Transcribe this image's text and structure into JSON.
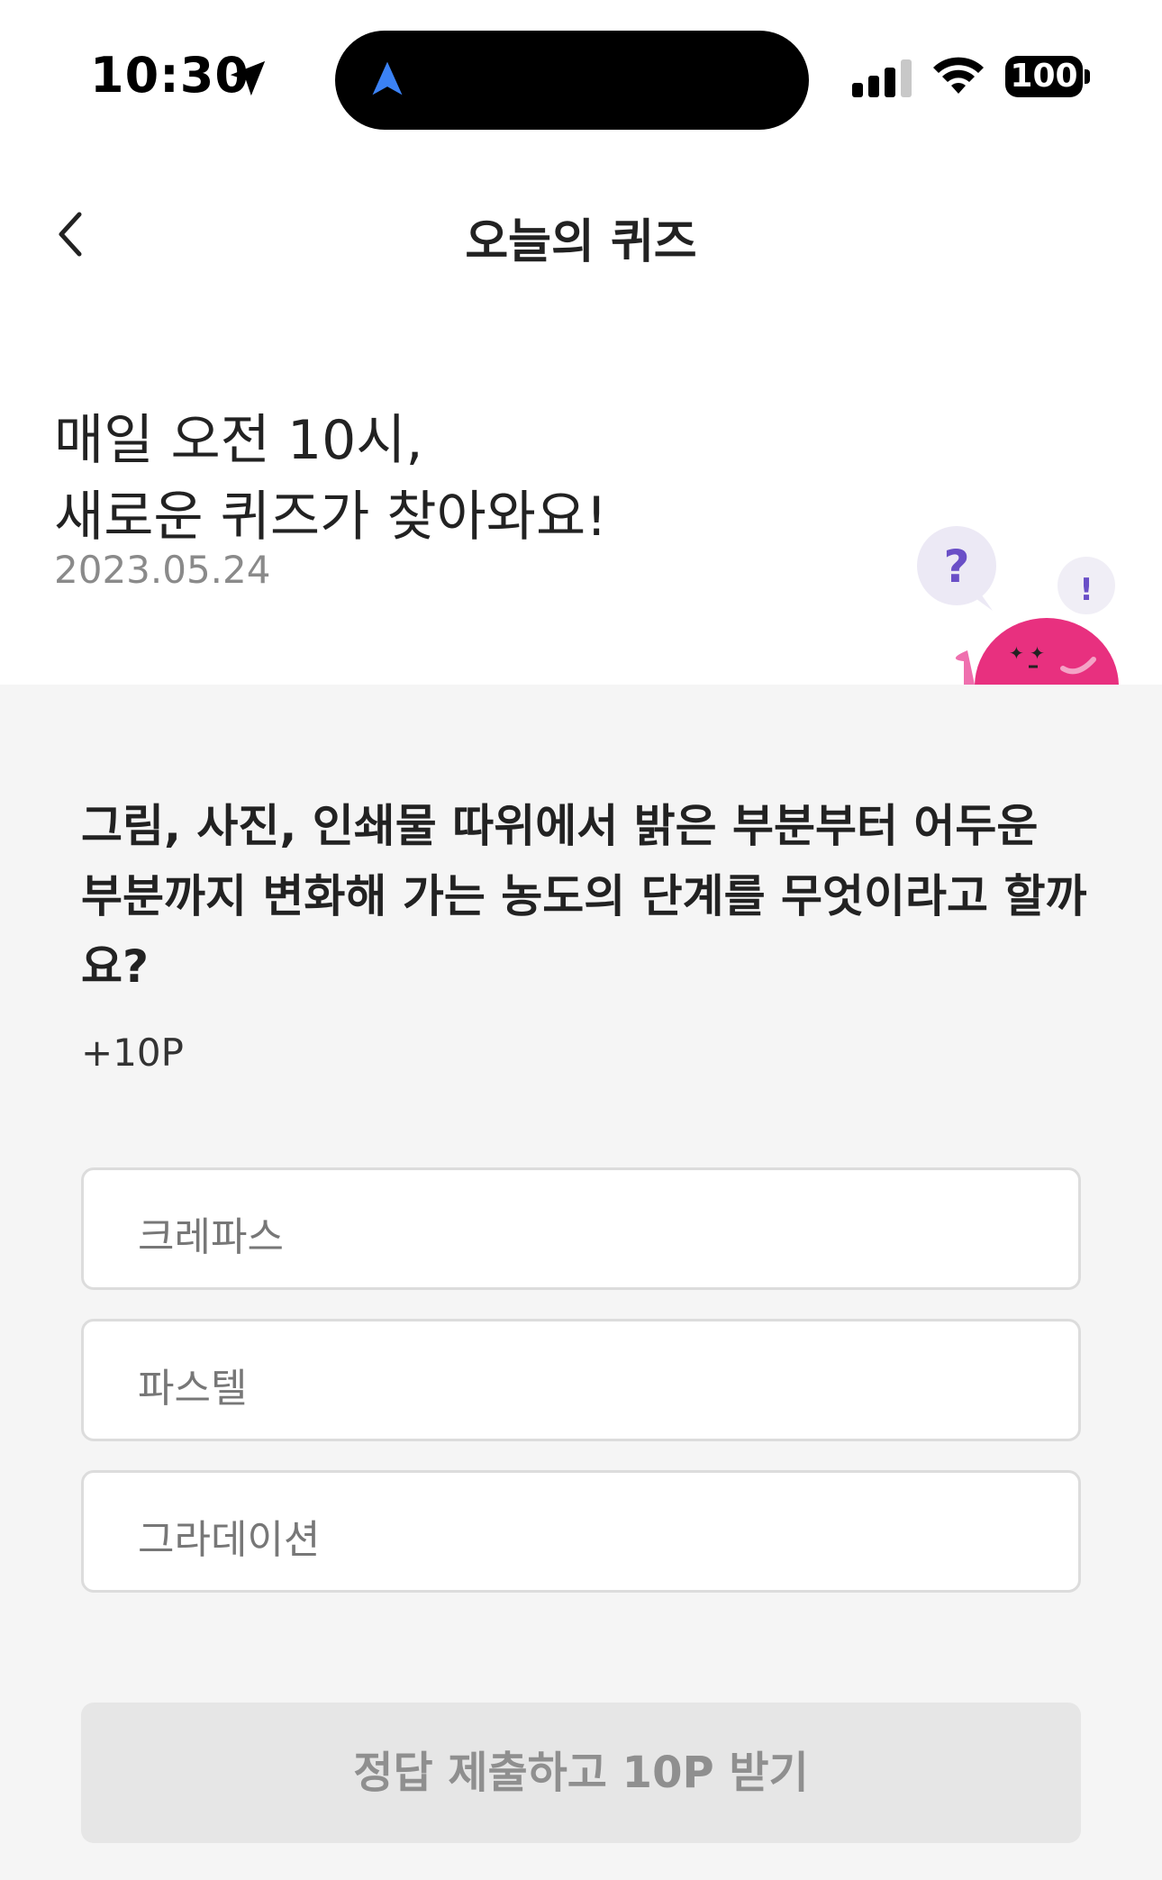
{
  "status_bar": {
    "time": "10:30",
    "battery": "100"
  },
  "header": {
    "title": "오늘의 퀴즈",
    "back_icon": "chevron-left-icon"
  },
  "hero": {
    "line1": "매일 오전 10시,",
    "line2": "새로운 퀴즈가 찾아와요!",
    "date": "2023.05.24",
    "mascot_bubble_question": "?",
    "mascot_bubble_exclaim": "!"
  },
  "quiz": {
    "question": "그림, 사진, 인쇄물 따위에서 밝은 부분부터 어두운 부분까지 변화해 가는 농도의 단계를 무엇이라고 할까요?",
    "points": "+10P",
    "options": [
      {
        "label": "크레파스"
      },
      {
        "label": "파스텔"
      },
      {
        "label": "그라데이션"
      }
    ],
    "submit_label": "정답 제출하고 10P 받기"
  },
  "colors": {
    "accent_pink": "#e8307f",
    "bubble_purple": "#6a4fc7",
    "nav_blue": "#3b82f6",
    "content_bg": "#f5f5f5",
    "submit_disabled_bg": "#e6e6e6"
  }
}
